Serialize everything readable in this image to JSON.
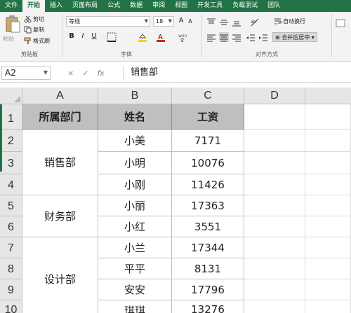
{
  "ribbon_tabs": [
    "文件",
    "开始",
    "插入",
    "页面布局",
    "公式",
    "数据",
    "审阅",
    "视图",
    "开发工具",
    "负载测试",
    "团队"
  ],
  "active_tab_index": 1,
  "clipboard": {
    "paste_label": "粘贴",
    "cut_label": "剪切",
    "copy_label": "复制",
    "format_painter_label": "格式刷",
    "group_label": "剪贴板"
  },
  "font": {
    "font_name": "等线",
    "font_size": "18",
    "bold": "B",
    "italic": "I",
    "underline": "U",
    "group_label": "字体"
  },
  "alignment": {
    "wrap_text_label": "自动换行",
    "merge_center_label": "合并后居中",
    "group_label": "对齐方式"
  },
  "formula_bar": {
    "name_box": "A2",
    "cancel_symbol": "×",
    "enter_symbol": "✓",
    "fx_symbol": "fx",
    "content": "销售部"
  },
  "columns": [
    "A",
    "B",
    "C",
    "D"
  ],
  "rows": [
    "1",
    "2",
    "3",
    "4",
    "5",
    "6",
    "7",
    "8",
    "9",
    "10"
  ],
  "headers": {
    "department": "所属部门",
    "name": "姓名",
    "salary": "工资"
  },
  "departments": [
    "销售部",
    "财务部",
    "设计部"
  ],
  "employees": [
    {
      "name": "小美",
      "salary": "7171"
    },
    {
      "name": "小明",
      "salary": "10076"
    },
    {
      "name": "小刚",
      "salary": "11426"
    },
    {
      "name": "小丽",
      "salary": "17363"
    },
    {
      "name": "小红",
      "salary": "3551"
    },
    {
      "name": "小兰",
      "salary": "17344"
    },
    {
      "name": "平平",
      "salary": "8131"
    },
    {
      "name": "安安",
      "salary": "17796"
    },
    {
      "name": "琪琪",
      "salary": "13276"
    }
  ],
  "colors": {
    "accent": "#217346",
    "header_fill": "#bfbfbf",
    "ribbon_bg": "#f3f3f3"
  }
}
